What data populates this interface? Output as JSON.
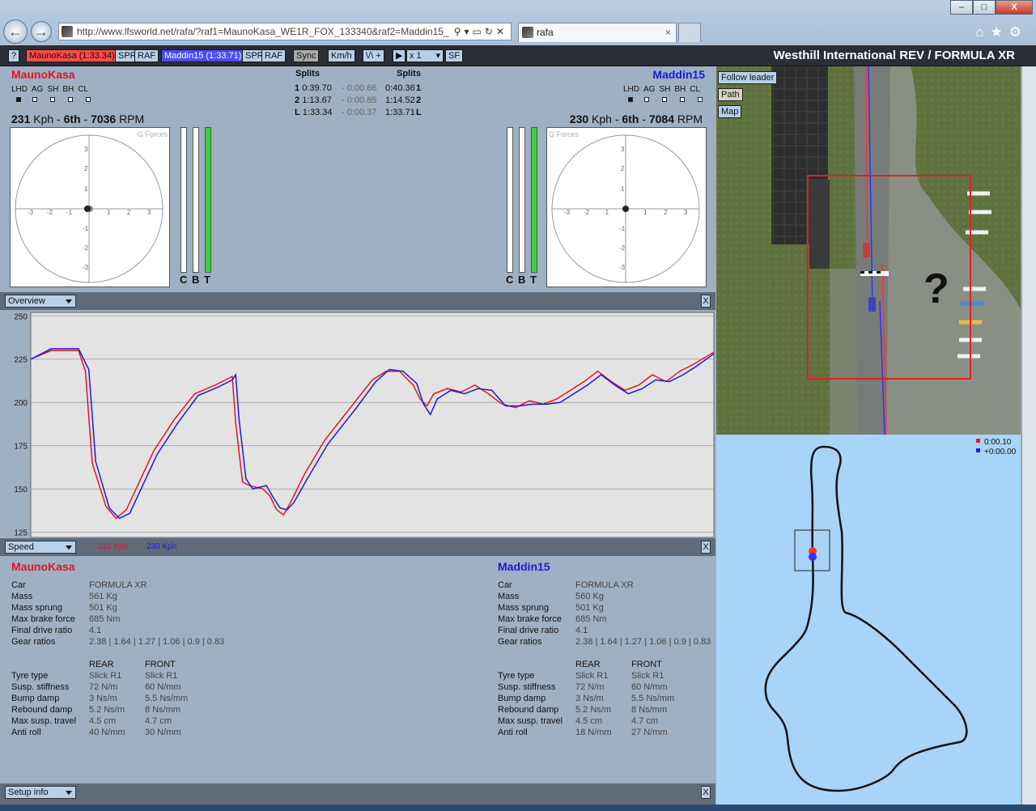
{
  "browser": {
    "url": "http://www.lfsworld.net/rafa/?raf1=MaunoKasa_WE1R_FOX_133340&raf2=Maddin15_",
    "tab_title": "rafa",
    "tab_close": "×",
    "win_min": "–",
    "win_max": "□",
    "win_close": "X"
  },
  "toolbar": {
    "help": "?",
    "player1": "MaunoKasa (1:33.34)",
    "player2": "Maddin15 (1:33.71)",
    "spr": "SPR",
    "raf": "RAF",
    "sync": "Sync",
    "units": "Km/h",
    "mode": "\\/\\ +",
    "speed": "x 1",
    "sf": "SF",
    "track": "Westhill International REV / FORMULA XR",
    "colors": {
      "p1": "#ff4a4a",
      "p2": "#4a4aff"
    }
  },
  "left_driver": {
    "name": "MaunoKasa",
    "indicators": [
      "LHD",
      "AG",
      "SH",
      "BH",
      "CL"
    ],
    "speed": "231",
    "speed_unit": " Kph - ",
    "gear": "6th",
    "gear_sep": " - ",
    "rpm": "7036",
    "rpm_unit": " RPM"
  },
  "right_driver": {
    "name": "Maddin15",
    "indicators": [
      "LHD",
      "AG",
      "SH",
      "BH",
      "CL"
    ],
    "speed": "230",
    "speed_unit": " Kph - ",
    "gear": "6th",
    "gear_sep": " - ",
    "rpm": "7084",
    "rpm_unit": " RPM"
  },
  "gforce": {
    "title": "G Forces",
    "ticks": [
      "-3",
      "-2",
      "-1",
      "1",
      "2",
      "3"
    ],
    "vticks": [
      "3",
      "2",
      "1",
      "-1",
      "-2",
      "-3"
    ]
  },
  "pedals": {
    "c": "C",
    "b": "B",
    "t": "T"
  },
  "splits": {
    "header": "Splits",
    "rows": [
      {
        "label": "1",
        "t1": "0:39.70",
        "diff": "- 0:00.66",
        "t2": "0:40.36"
      },
      {
        "label": "2",
        "t1": "1:13.67",
        "diff": "- 0:00.85",
        "t2": "1:14.52"
      },
      {
        "label": "L",
        "t1": "1:33.34",
        "diff": "- 0:00.37",
        "t2": "1:33.71"
      }
    ]
  },
  "sections": {
    "overview": "Overview",
    "speed": "Speed",
    "setup": "Setup info",
    "close": "X",
    "speed_p1": "231 Kph",
    "speed_p2": "230 Kph"
  },
  "chart_data": {
    "type": "line",
    "title": "",
    "xlabel": "",
    "ylabel": "",
    "ylim": [
      122,
      252
    ],
    "yticks": [
      250,
      225,
      200,
      175,
      150,
      125
    ],
    "grid": true,
    "series": [
      {
        "name": "MaunoKasa",
        "color": "#e8121e",
        "x": [
          0,
          3,
          7,
          8,
          9,
          11,
          12.5,
          14,
          16,
          18,
          21,
          24,
          27,
          29,
          29.5,
          30,
          31,
          32,
          34,
          35,
          36,
          37,
          38,
          40,
          43,
          47,
          50,
          52,
          54,
          56,
          57,
          58,
          59,
          61,
          63,
          65,
          67,
          69,
          71,
          73,
          75,
          77,
          79,
          81,
          83,
          85,
          87,
          89,
          91,
          93,
          95,
          97,
          100
        ],
        "y": [
          225,
          230,
          230,
          218,
          165,
          140,
          133,
          138,
          155,
          172,
          190,
          205,
          210,
          214,
          215,
          188,
          154,
          152,
          150,
          146,
          138,
          135,
          142,
          158,
          178,
          198,
          213,
          218,
          218,
          210,
          202,
          198,
          205,
          208,
          206,
          210,
          205,
          199,
          197,
          201,
          199,
          202,
          207,
          212,
          218,
          212,
          207,
          210,
          216,
          212,
          218,
          222,
          229
        ]
      },
      {
        "name": "Maddin15",
        "color": "#1a1ad6",
        "x": [
          0,
          3,
          7,
          8.5,
          9.5,
          11.5,
          13,
          14.5,
          16.5,
          18.5,
          21.5,
          24.5,
          27.5,
          29.5,
          30,
          30.5,
          31.5,
          32.5,
          34.5,
          35.5,
          36.5,
          37.5,
          38.5,
          40.5,
          43.5,
          47.5,
          50.5,
          52.5,
          54.5,
          56.5,
          57.5,
          58.5,
          59.5,
          61.5,
          63.5,
          65.5,
          67.5,
          69.5,
          71.5,
          73.5,
          75.5,
          77.5,
          79.5,
          81.5,
          83.5,
          85.5,
          87.5,
          89.5,
          91.5,
          93.5,
          95.5,
          97.5,
          100
        ],
        "y": [
          225,
          231,
          231,
          219,
          166,
          139,
          133,
          136,
          153,
          170,
          188,
          204,
          209,
          213,
          216,
          190,
          156,
          150,
          152,
          145,
          139,
          138,
          142,
          156,
          176,
          196,
          212,
          219,
          218,
          211,
          199,
          193,
          202,
          207,
          205,
          208,
          207,
          198,
          198,
          199,
          199,
          200,
          205,
          210,
          216,
          210,
          205,
          208,
          213,
          212,
          216,
          221,
          228
        ]
      }
    ]
  },
  "setup": {
    "left": {
      "name": "MaunoKasa",
      "rows": [
        {
          "k": "Car",
          "v": "FORMULA XR"
        },
        {
          "k": "Mass",
          "v": "561 Kg"
        },
        {
          "k": "Mass sprung",
          "v": "501 Kg"
        },
        {
          "k": "Max brake force",
          "v": "685 Nm"
        },
        {
          "k": "Final drive ratio",
          "v": "4.1"
        },
        {
          "k": "Gear ratios",
          "v": "2.38 | 1.64 | 1.27 | 1.06 | 0.9 | 0.83"
        }
      ],
      "rear": "REAR",
      "front": "FRONT",
      "susp": [
        {
          "k": "Tyre type",
          "r": "Slick R1",
          "f": "Slick R1"
        },
        {
          "k": "Susp. stiffness",
          "r": "72 N/m",
          "f": "60 N/mm"
        },
        {
          "k": "Bump damp",
          "r": "3 Ns/m",
          "f": "5.5 Ns/mm"
        },
        {
          "k": "Rebound damp",
          "r": "5.2 Ns/m",
          "f": "8 Ns/mm"
        },
        {
          "k": "Max susp. travel",
          "r": "4.5 cm",
          "f": "4.7 cm"
        },
        {
          "k": "Anti roll",
          "r": "40 N/mm",
          "f": "30 N/mm"
        }
      ]
    },
    "right": {
      "name": "Maddin15",
      "rows": [
        {
          "k": "Car",
          "v": "FORMULA XR"
        },
        {
          "k": "Mass",
          "v": "560 Kg"
        },
        {
          "k": "Mass sprung",
          "v": "501 Kg"
        },
        {
          "k": "Max brake force",
          "v": "685 Nm"
        },
        {
          "k": "Final drive ratio",
          "v": "4.1"
        },
        {
          "k": "Gear ratios",
          "v": "2.38 | 1.64 | 1.27 | 1.06 | 0.9 | 0.83"
        }
      ],
      "rear": "REAR",
      "front": "FRONT",
      "susp": [
        {
          "k": "Tyre type",
          "r": "Slick R1",
          "f": "Slick R1"
        },
        {
          "k": "Susp. stiffness",
          "r": "72 N/m",
          "f": "60 N/mm"
        },
        {
          "k": "Bump damp",
          "r": "3 Ns/m",
          "f": "5.5 Ns/mm"
        },
        {
          "k": "Rebound damp",
          "r": "5.2 Ns/m",
          "f": "8 Ns/mm"
        },
        {
          "k": "Max susp. travel",
          "r": "4.5 cm",
          "f": "4.7 cm"
        },
        {
          "k": "Anti roll",
          "r": "18 N/mm",
          "f": "27 N/mm"
        }
      ]
    }
  },
  "view": {
    "follow": "Follow leader",
    "path": "Path",
    "map": "Map",
    "question": "?",
    "gap1": "0:00.10",
    "gap2": "+0:00.00"
  }
}
